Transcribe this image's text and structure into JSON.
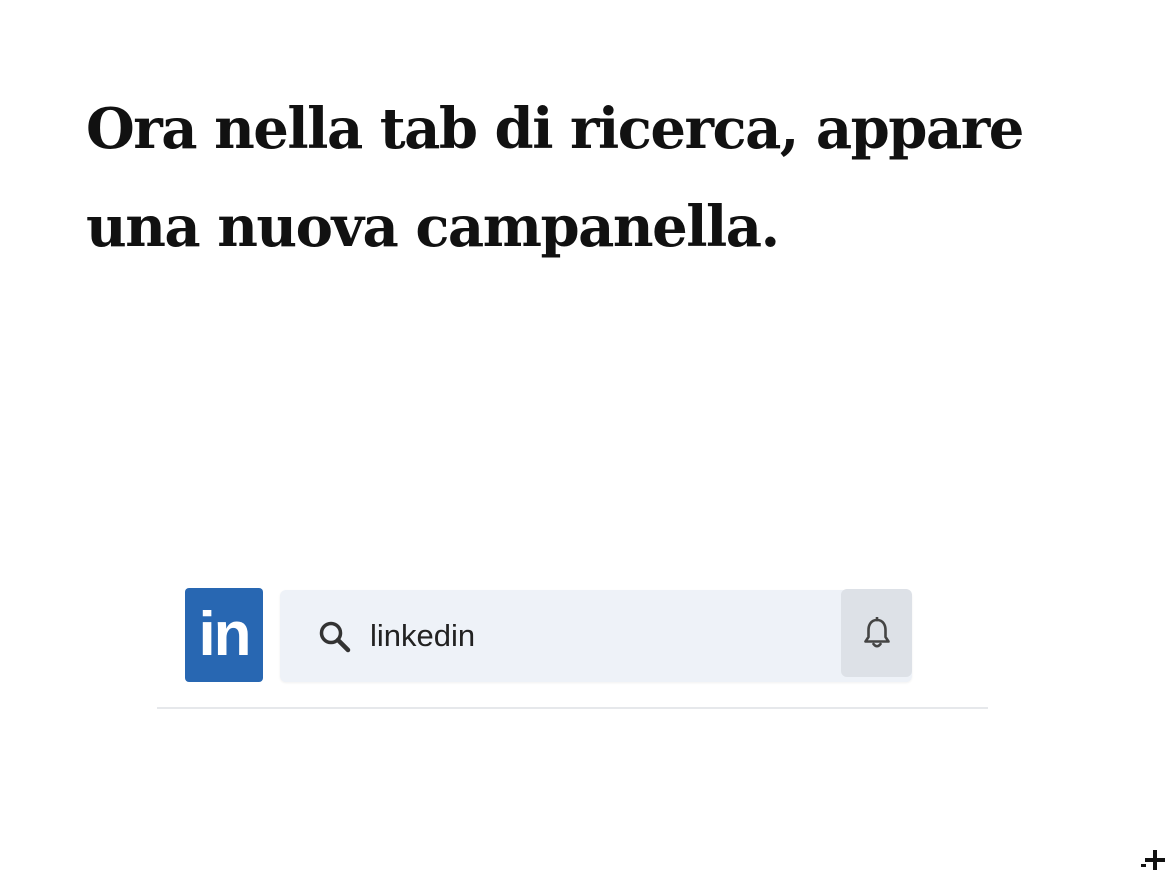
{
  "headline": {
    "line1": "Ora nella tab di ricerca, appare",
    "line2": "una nuova campanella."
  },
  "toolbar": {
    "logo_text": "in",
    "search_value": "linkedin",
    "logo_color": "#2867b2",
    "search_bg": "#eef2f8",
    "bell_bg": "#dde1e7"
  },
  "icons": {
    "search": "search-icon",
    "bell": "bell-icon",
    "logo": "linkedin-logo"
  }
}
